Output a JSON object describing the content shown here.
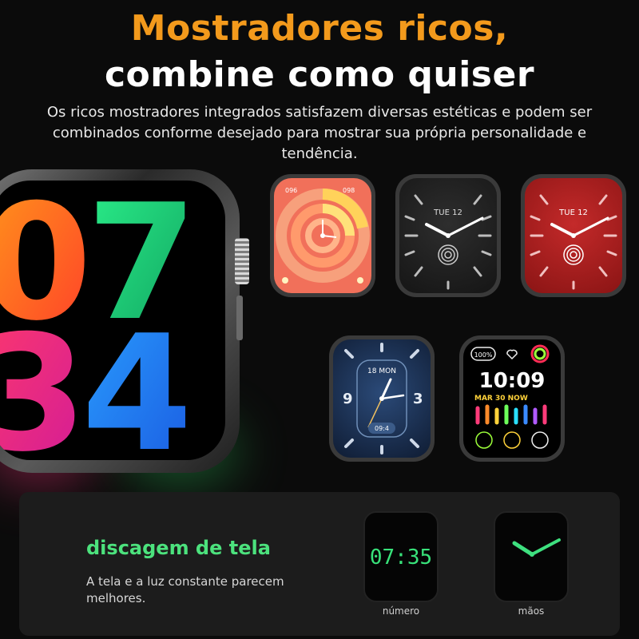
{
  "header": {
    "title_line1": "Mostradores ricos,",
    "title_line2": "combine como quiser",
    "description": "Os ricos mostradores integrados satisfazem diversas estéticas e podem ser combinados conforme desejado para mostrar sua própria personalidade e tendência."
  },
  "big_watch": {
    "digits": [
      "0",
      "7",
      "3",
      "4"
    ],
    "colors": [
      "#ff6a1a",
      "#1ad17a",
      "#ff2b7a",
      "#1e7bff"
    ]
  },
  "faces": {
    "coral": {
      "left_label": "096",
      "right_label": "098"
    },
    "dark": {
      "date": "TUE 12"
    },
    "red": {
      "date": "TUE 12"
    },
    "blue": {
      "date": "18 MON",
      "bottom": "09:4",
      "num_left": "9",
      "num_right": "3"
    },
    "digital": {
      "badge": "100%",
      "time": "10:09",
      "date": "MAR 30 NOW"
    }
  },
  "panel": {
    "title": "discagem de tela",
    "description": "A tela e a luz constante parecem melhores.",
    "digital_time": "07:35",
    "label_number": "número",
    "label_hands": "mãos"
  },
  "colors": {
    "accent_orange": "#f39a1c",
    "accent_green": "#4ce27d"
  }
}
